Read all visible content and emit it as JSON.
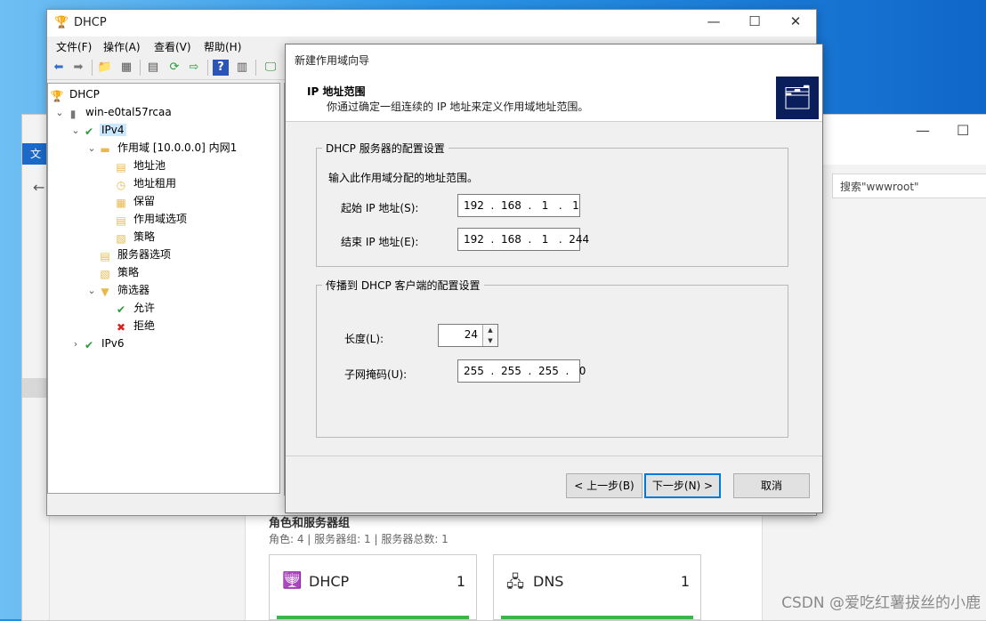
{
  "background_window": {
    "tab_text": "文",
    "search_placeholder": "搜索\"wwwroot\"",
    "roles_title": "角色和服务器组",
    "roles_subtitle": "角色: 4 | 服务器组: 1 | 服务器总数: 1",
    "tiles": [
      {
        "name": "DHCP",
        "count": "1"
      },
      {
        "name": "DNS",
        "count": "1"
      }
    ]
  },
  "mmc": {
    "title": "DHCP",
    "menu": [
      "文件(F)",
      "操作(A)",
      "查看(V)",
      "帮助(H)"
    ],
    "tree": [
      {
        "label": "DHCP",
        "indent": 0
      },
      {
        "label": "win-e0tal57rcaa",
        "indent": 1
      },
      {
        "label": "IPv4",
        "indent": 2
      },
      {
        "label": "作用域 [10.0.0.0] 内网1",
        "indent": 3
      },
      {
        "label": "地址池",
        "indent": 4
      },
      {
        "label": "地址租用",
        "indent": 4
      },
      {
        "label": "保留",
        "indent": 4
      },
      {
        "label": "作用域选项",
        "indent": 4
      },
      {
        "label": "策略",
        "indent": 4
      },
      {
        "label": "服务器选项",
        "indent": 3
      },
      {
        "label": "策略",
        "indent": 3
      },
      {
        "label": "筛选器",
        "indent": 3
      },
      {
        "label": "允许",
        "indent": 4
      },
      {
        "label": "拒绝",
        "indent": 4
      },
      {
        "label": "IPv6",
        "indent": 2
      }
    ]
  },
  "wizard": {
    "title": "新建作用域向导",
    "header_title": "IP 地址范围",
    "header_desc": "你通过确定一组连续的 IP 地址来定义作用域地址范围。",
    "group1_legend": "DHCP 服务器的配置设置",
    "group1_instruction": "输入此作用域分配的地址范围。",
    "start_ip_label": "起始 IP 地址(S):",
    "start_ip_value": "192  .  168  .   1   .   1",
    "end_ip_label": "结束 IP 地址(E):",
    "end_ip_value": "192  .  168  .   1   .  244",
    "group2_legend": "传播到 DHCP 客户端的配置设置",
    "length_label": "长度(L):",
    "length_value": "24",
    "mask_label": "子网掩码(U):",
    "mask_value": "255  .  255  .  255  .   0",
    "back_button": "< 上一步(B)",
    "next_button": "下一步(N) >",
    "cancel_button": "取消"
  },
  "watermark": "CSDN @爱吃红薯拔丝的小鹿"
}
